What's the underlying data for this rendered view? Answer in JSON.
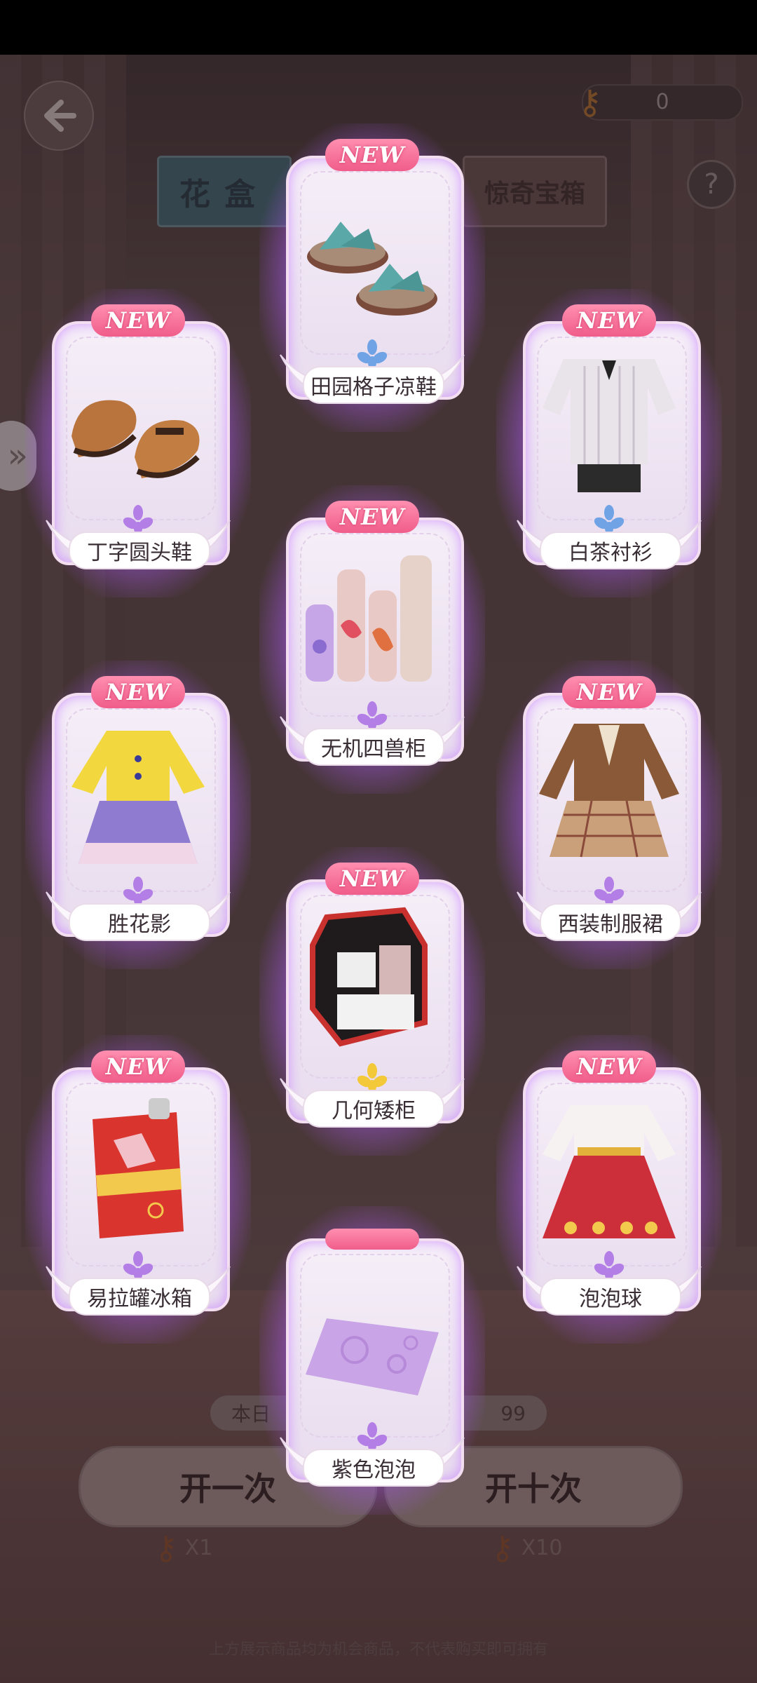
{
  "header": {
    "back_icon": "back-arrow-icon",
    "key_count": "0",
    "help_label": "?",
    "tabs": [
      {
        "label": "花盒",
        "active": true
      },
      {
        "label": "惊奇宝箱",
        "active": false
      }
    ],
    "side_toggle_icon": "double-chevron-right-icon"
  },
  "draw_panel": {
    "odds_left": "本日",
    "odds_right": "99",
    "open_one_label": "开一次",
    "open_ten_label": "开十次",
    "cost_one": "X1",
    "cost_ten": "X10",
    "footer_note": "上方展示商品均为机会商品，不代表购买即可拥有"
  },
  "badge_text": "NEW",
  "colors": {
    "card_glow": "#c982ff",
    "badge_pink": "#f05d8a",
    "tab_active": "#3f6a74",
    "flower_purple": "#b37ee6",
    "flower_blue": "#6fa3e6",
    "flower_gold": "#f3c93a"
  },
  "rewards": [
    {
      "name": "田园格子凉鞋",
      "is_new": true,
      "rarity_flower": "blue",
      "art": "gingham-sandals"
    },
    {
      "name": "丁字圆头鞋",
      "is_new": true,
      "rarity_flower": "purple",
      "art": "brown-tstrap-shoes"
    },
    {
      "name": "白茶衬衫",
      "is_new": true,
      "rarity_flower": "blue",
      "art": "striped-shirt-shorts"
    },
    {
      "name": "无机四兽柜",
      "is_new": true,
      "rarity_flower": "purple",
      "art": "four-cabinets"
    },
    {
      "name": "胜花影",
      "is_new": true,
      "rarity_flower": "purple",
      "art": "yellow-qipao-dress"
    },
    {
      "name": "西装制服裙",
      "is_new": true,
      "rarity_flower": "purple",
      "art": "blazer-plaid-skirt"
    },
    {
      "name": "几何矮柜",
      "is_new": true,
      "rarity_flower": "gold",
      "art": "geometric-cabinet"
    },
    {
      "name": "易拉罐冰箱",
      "is_new": true,
      "rarity_flower": "purple",
      "art": "soda-can-fridge"
    },
    {
      "name": "泡泡球",
      "is_new": true,
      "rarity_flower": "purple",
      "art": "red-duck-dress"
    },
    {
      "name": "紫色泡泡",
      "is_new": false,
      "rarity_flower": "purple",
      "art": "purple-rug"
    }
  ]
}
